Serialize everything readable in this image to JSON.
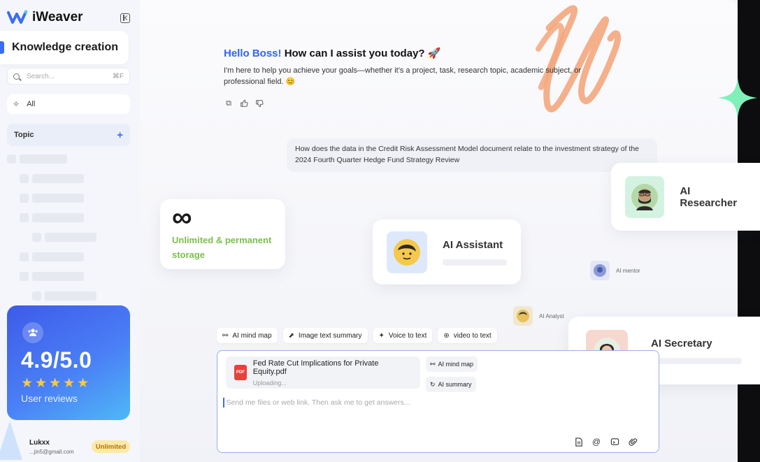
{
  "app": {
    "name": "iWeaver"
  },
  "sidebar": {
    "active_section": "Knowledge creation",
    "search": {
      "placeholder": "Search...",
      "shortcut": "⌘F"
    },
    "all_label": "All",
    "topic_label": "Topic",
    "topic_add": "+"
  },
  "rating": {
    "value": "4.9/5.0",
    "stars": "★★★★★",
    "caption": "User reviews"
  },
  "user": {
    "name": "Lukxx",
    "email": "...jin5@gmail.com",
    "plan": "Unlimited"
  },
  "greeting": {
    "hello": "Hello Boss!",
    "question": "How can I assist you today? 🚀",
    "body": "I'm here to help you achieve your goals—whether it's a project, task, research topic, academic subject, or professional field. 😊"
  },
  "query": "How does the data in the Credit Risk Assessment Model document relate to the investment strategy of the 2024 Fourth Quarter Hedge Fund Strategy Review",
  "feature_cards": {
    "storage_symbol": "∞",
    "storage": "Unlimited & permanent storage",
    "assistant": "AI Assistant",
    "researcher": "AI Researcher",
    "secretary": "AI Secretary",
    "mentor": "AI mentor",
    "analyst": "AI Analyst"
  },
  "toolbar": [
    {
      "icon": "mindmap-icon",
      "label": "AI mind map"
    },
    {
      "icon": "image-text-icon",
      "label": "Image text summary"
    },
    {
      "icon": "voice-icon",
      "label": "Voice to text"
    },
    {
      "icon": "video-icon",
      "label": "video to text"
    }
  ],
  "composer": {
    "file_name": "Fed Rate Cut Implications for Private Equity.pdf",
    "file_status": "Uploading...",
    "file_type": "PDF",
    "chip_mindmap": "AI mind map",
    "chip_summary": "AI summary",
    "placeholder": "Send me files or web link. Then ask me to get answers..."
  },
  "colors": {
    "brand": "#3b6cf5",
    "storage_green": "#7bbf4a",
    "rating_gradient_start": "#3d5be8",
    "rating_gradient_end": "#4fb8f7",
    "unlimited_badge": "#fde9a8",
    "scribble": "#f3a77e",
    "sparkle": "#7ff0b8"
  }
}
